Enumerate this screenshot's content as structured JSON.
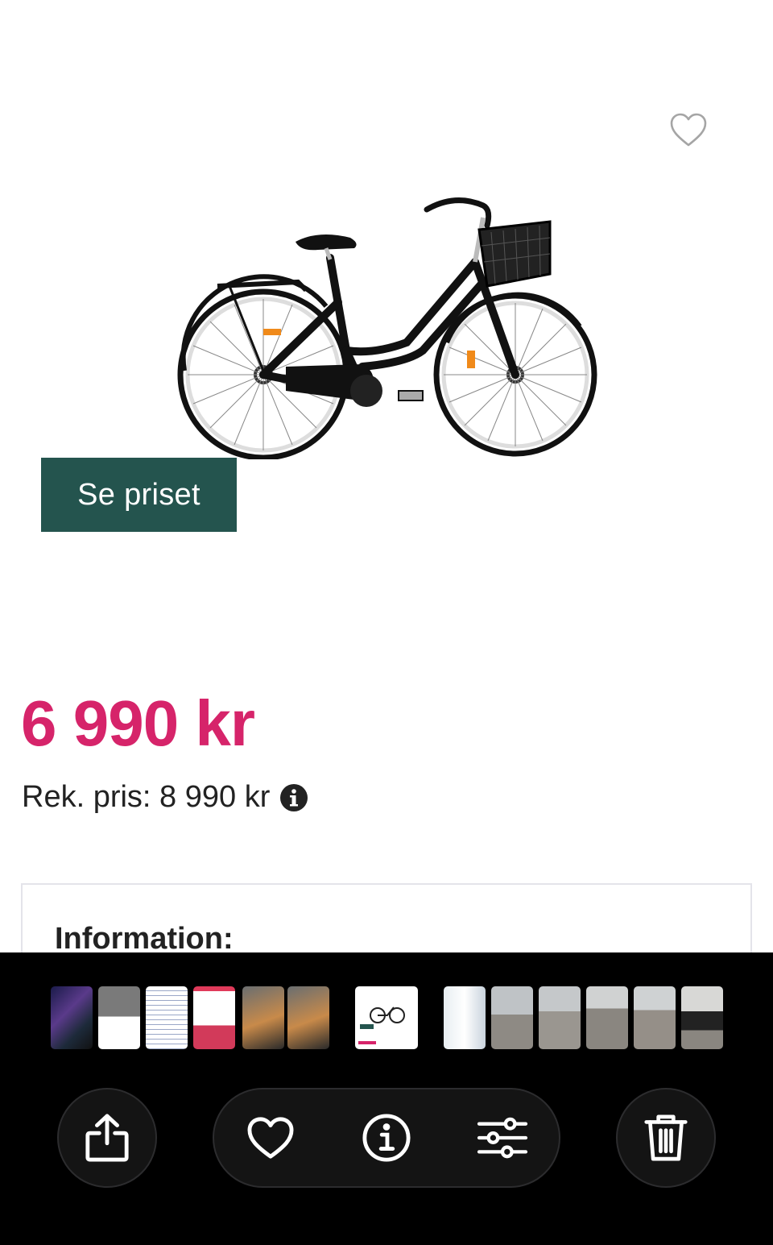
{
  "product": {
    "cta_label": "Se priset",
    "price": "6 990 kr",
    "rrp_label": "Rek. pris: 8 990 kr",
    "info_heading": "Information:"
  },
  "icons": {
    "favorite": "heart-outline-icon",
    "rrp_info": "info-circle-filled-icon",
    "share": "share-icon",
    "like": "heart-icon",
    "info": "info-icon",
    "adjust": "sliders-icon",
    "delete": "trash-icon"
  },
  "colors": {
    "price": "#d6246a",
    "cta_background": "#24544e",
    "viewer_background": "#000000"
  },
  "photo_strip": {
    "active_index": 6,
    "thumbnails": [
      "photo-dark-screen",
      "photo-screenshot-list",
      "photo-screenshot-text",
      "photo-screenshot-product",
      "photo-bicycle-indoor",
      "photo-bicycle-indoor",
      "photo-bicycle-product",
      "photo-device-white",
      "photo-bicycle-outdoor",
      "photo-bicycle-outdoor",
      "photo-bicycle-outdoor",
      "photo-bicycle-outdoor",
      "photo-bicycle-saddle"
    ]
  }
}
